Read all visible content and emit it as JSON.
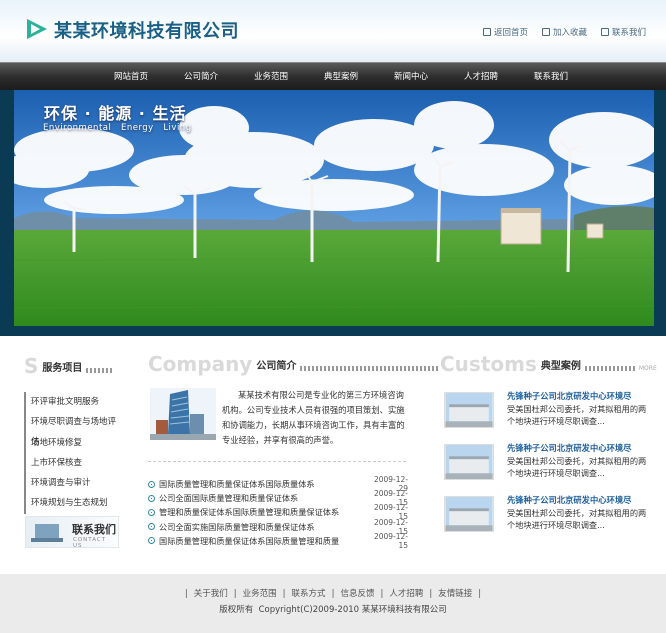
{
  "header": {
    "title": "某某环境科技有限公司",
    "links": [
      {
        "label": "返回首页",
        "icon": "home-icon"
      },
      {
        "label": "加入收藏",
        "icon": "favorite-icon"
      },
      {
        "label": "联系我们",
        "icon": "mail-icon"
      }
    ]
  },
  "nav": {
    "items": [
      "网站首页",
      "公司简介",
      "业务范围",
      "典型案例",
      "新闻中心",
      "人才招聘",
      "联系我们"
    ]
  },
  "banner": {
    "title": "环保 · 能源 · 生活",
    "subtitle": "Environmental   Energy   Living"
  },
  "services": {
    "en_letter": "S",
    "heading": "服务项目",
    "items": [
      "环评审批文明服务",
      "环境尽职调查与场地评估",
      "场地环境修复",
      "上市环保核查",
      "环境调查与审计",
      "环境规划与生态规划"
    ],
    "contact_cn": "联系我们",
    "contact_en": "CONTACT US"
  },
  "about": {
    "en_heading": "Company",
    "heading": "公司简介",
    "text": "某某技术有限公司是专业化的第三方环境咨询机构。公司专业技术人员有很强的项目策划、实施和协调能力，长期从事环境咨询工作，具有丰富的专业经验，并享有很高的声誉。"
  },
  "news": [
    {
      "title": "国际质量管理和质量保证体系国际质量体系",
      "date": "2009-12-29"
    },
    {
      "title": "公司全面国际质量管理和质量保证体系",
      "date": "2009-12-15"
    },
    {
      "title": "管理和质量保证体系国际质量管理和质量保证体系",
      "date": "2009-12-15"
    },
    {
      "title": "公司全面实施国际质量管理和质量保证体系",
      "date": "2009-12-15"
    },
    {
      "title": "国际质量管理和质量保证体系国际质量管理和质量",
      "date": "2009-12-15"
    }
  ],
  "cases": {
    "en_heading": "Customs",
    "heading": "典型案例",
    "more": "MORE",
    "items": [
      {
        "title": "先锋种子公司北京研发中心环境尽",
        "desc": "受美国杜邦公司委托，对其拟租用的两个地块进行环境尽职调查..."
      },
      {
        "title": "先锋种子公司北京研发中心环境尽",
        "desc": "受美国杜邦公司委托，对其拟租用的两个地块进行环境尽职调查..."
      },
      {
        "title": "先锋种子公司北京研发中心环境尽",
        "desc": "受美国杜邦公司委托，对其拟租用的两个地块进行环境尽职调查..."
      }
    ]
  },
  "footer": {
    "links": [
      "关于我们",
      "业务范围",
      "联系方式",
      "信息反馈",
      "人才招聘",
      "友情链接"
    ],
    "copyright": "版权所有  Copyright(C)2009-2010 某某环境科技有限公司"
  },
  "colors": {
    "accent": "#1a5f86",
    "nav": "#2e2e2e",
    "logo": "#2bb39a"
  }
}
